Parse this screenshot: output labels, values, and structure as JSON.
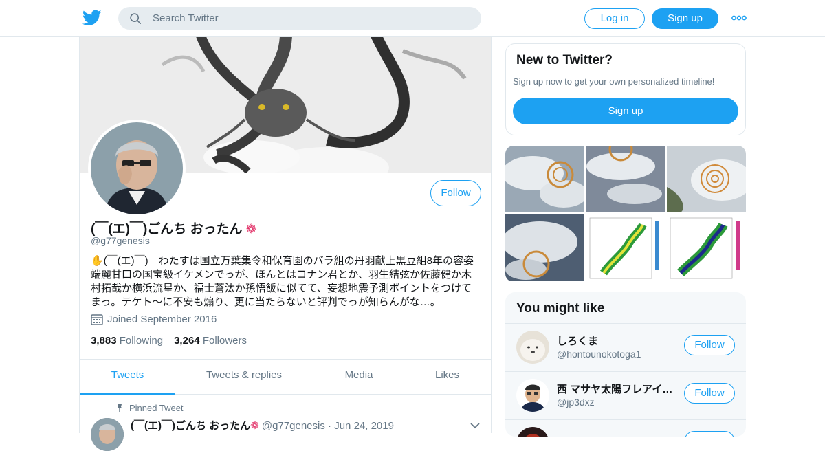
{
  "nav": {
    "search_placeholder": "Search Twitter",
    "login_label": "Log in",
    "signup_label": "Sign up",
    "icons": [
      "twitter-logo-icon",
      "search-icon",
      "more-icon"
    ],
    "brand_color": "#1da1f2"
  },
  "profile": {
    "name": "(￣(エ)￣)ごんち おったん",
    "name_badge": "❁",
    "handle": "@g77genesis",
    "follow_label": "Follow",
    "bio": "✋(￣(エ)￣)　わたすは国立万葉集令和保育園のバラ組の丹羽献上黒豆組8年の容姿端麗甘口の国宝級イケメンでっが、ほんとはコナン君とか、羽生結弦か佐藤健か木村拓哉か横浜流星か、福士蒼汰か孫悟飯に似てて、妄想地震予測ポイントをつけてまっ。テケト〜に不安も煽り、更に当たらないと評判でっが知らんがな…。",
    "joined": "Joined September 2016",
    "following_count": "3,883",
    "following_label": "Following",
    "followers_count": "3,264",
    "followers_label": "Followers"
  },
  "tabs": [
    {
      "label": "Tweets",
      "active": true
    },
    {
      "label": "Tweets & replies",
      "active": false
    },
    {
      "label": "Media",
      "active": false
    },
    {
      "label": "Likes",
      "active": false
    }
  ],
  "pinned_tweet": {
    "pinned_label": "Pinned Tweet",
    "name": "(￣(エ)￣)ごんち おったん",
    "badge": "❁",
    "handle": "@g77genesis",
    "separator": "·",
    "date": "Jun 24, 2019"
  },
  "new_to_twitter": {
    "title": "New to Twitter?",
    "subtitle": "Sign up now to get your own personalized timeline!",
    "signup_label": "Sign up"
  },
  "you_might_like": {
    "title": "You might like",
    "users": [
      {
        "name": "しろくま",
        "handle": "@hontounokotoga1",
        "follow_label": "Follow"
      },
      {
        "name": "西 マサヤ太陽フレアイ…",
        "handle": "@jp3dxz",
        "follow_label": "Follow"
      }
    ]
  }
}
